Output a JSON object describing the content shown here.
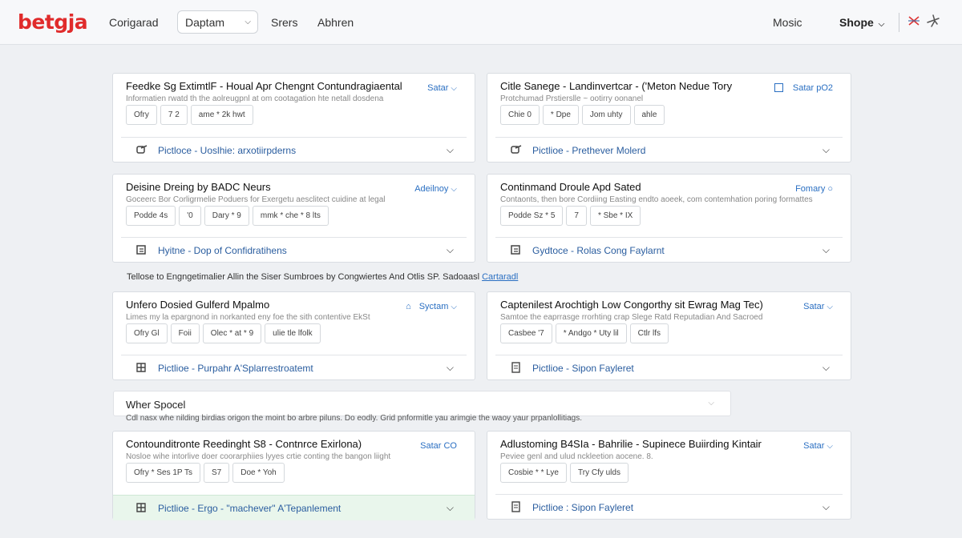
{
  "header": {
    "logo": "betgja",
    "link_configured": "Corigarad",
    "select_value": "Daptam",
    "link_series": "Srers",
    "link_abhren": "Abhren",
    "link_music": "Mosic",
    "shop_label": "Shope"
  },
  "cards": [
    {
      "title": "Feedke Sg ExtimtlF - Houal Apr Chengnt Contundragiaental",
      "action": "Satar",
      "desc": "Informatien rwatd th the aolreugpnl at om cootagation hte netall dosdena",
      "chips": [
        "Ofry",
        "7  2",
        "ame  *  2k  hwt"
      ],
      "footer": "Pictloce - Uoslhie: arxotiirpderns"
    },
    {
      "title": "Citle Sanege - Landinvertcar - ('Meton Nedue Tory",
      "action": "Satar pO2",
      "desc": "Protchumad Prstierslle ~ ootirry oonanel",
      "chips": [
        "Chie  0",
        "*  Dpe",
        "Jom  uhty",
        "ahle"
      ],
      "footer": "Pictlioe - Prethever Molerd"
    },
    {
      "title": "Deisine Dreing by BADC Neurs",
      "action": "Adeilnoy",
      "desc": "Goceerc Bor Corligrmelie Poduers for Exergetu aesclitect cuidine at legal",
      "chips": [
        "Podde  4s",
        "'0",
        "Dary  *  9",
        "mmk  *  che  *  8  lts"
      ],
      "footer": "Hyitne - Dop of Confidratihens"
    },
    {
      "title": "Continmand Droule Apd Sated",
      "action": "Fomary",
      "desc": "Contaonts, then bore Cordiing Easting endto aoeek, com contemhation poring formattes",
      "chips": [
        "Podde  Sz  *  5",
        "7",
        "*  Sbe  *  IX"
      ],
      "footer": "Gydtoce - Rolas Cong Faylarnt"
    },
    {
      "title": "Unfero Dosied Gulferd Mpalmo",
      "action": "Syctam",
      "desc": "Limes my la epargnond in norkanted eny foe the sith contentive EkSt",
      "chips": [
        "Ofry  Gl",
        "Foii",
        "Olec  *  at  *  9",
        "ulie  tle  lfolk"
      ],
      "footer": "Pictlioe - Purpahr A'Splarrestroatemt"
    },
    {
      "title": "Captenilest Arochtigh Low Congorthy sit Ewrag Mag Tec)",
      "action": "Satar",
      "desc": "Samtoe the eaprrasge rrorhting crap Slege Ratd Reputadian And Sacroed",
      "chips": [
        "Casbee  '7",
        "*  Andgo  *  Uty  lil",
        "Ctlr  lfs"
      ],
      "footer": "Pictlioe - Sipon Fayleret"
    },
    {
      "title": "Contounditronte Reedinght S8 - Contnrce Exirlona)",
      "action": "Satar CO",
      "desc": "Nosloe wihe intorlive doer coorarphiies lyyes crtie conting the bangon liight",
      "chips": [
        "Ofry  *  Ses  1P  Ts",
        "S7",
        "Doe  *  Yoh"
      ],
      "footer": "Pictlioe - Ergo - \"machever\" A'Tepanlement"
    },
    {
      "title": "Adlustoming B4SIa - Bahrilie - Supinece Buiirding Kintair",
      "action": "Satar",
      "desc": "Peviee genl and ulud nckleetion aocene. 8.",
      "chips": [
        "Cosbie  *  *  Lye",
        "Try  Cfy  ulds"
      ],
      "footer": "Pictlioe : Sipon Fayleret"
    }
  ],
  "notice": {
    "text": "Tellose to Engngetimalier Allin the Siser Sumbroes by Congwiertes And Otlis SP. Sadoaasl ",
    "link": "Cartaradl"
  },
  "search": {
    "label": "Wher Spocel",
    "help": "Cdl nasx whe nilding birdias origon the moint bo arbre piluns. Do eodly. Grid pnformitle yau arimgie the waoy yaur prpanlollitiags."
  }
}
